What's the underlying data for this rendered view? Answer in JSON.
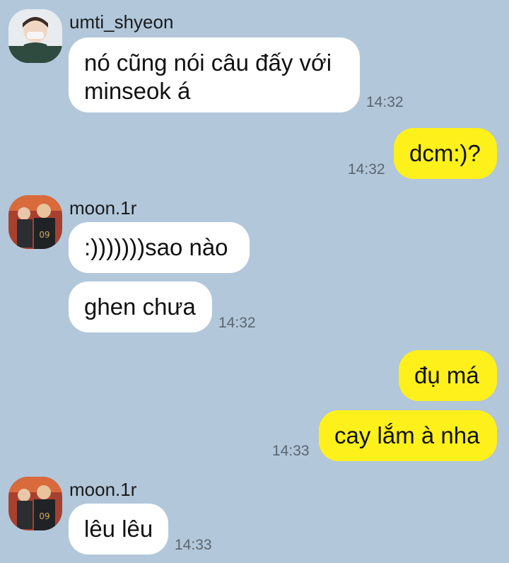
{
  "colors": {
    "background": "#b2c7da",
    "incoming_bubble": "#ffffff",
    "outgoing_bubble": "#fef01b"
  },
  "messages": [
    {
      "sender": "umti_shyeon",
      "avatar_icon": "person-avatar-icon",
      "text_lines": [
        "nó cũng nói câu đấy với",
        "minseok á"
      ],
      "time": "14:32"
    },
    {
      "sender": "me",
      "text": "dcm:)?",
      "time": "14:32"
    },
    {
      "sender": "moon.1r",
      "avatar_icon": "person-avatar-icon",
      "text": ":)))))))sao nào"
    },
    {
      "sender": "moon.1r",
      "text": "ghen chưa",
      "time": "14:32"
    },
    {
      "sender": "me",
      "text": "đụ má"
    },
    {
      "sender": "me",
      "text": "cay lắm à nha",
      "time": "14:33"
    },
    {
      "sender": "moon.1r",
      "avatar_icon": "person-avatar-icon",
      "text": "lêu lêu",
      "time": "14:33"
    }
  ]
}
